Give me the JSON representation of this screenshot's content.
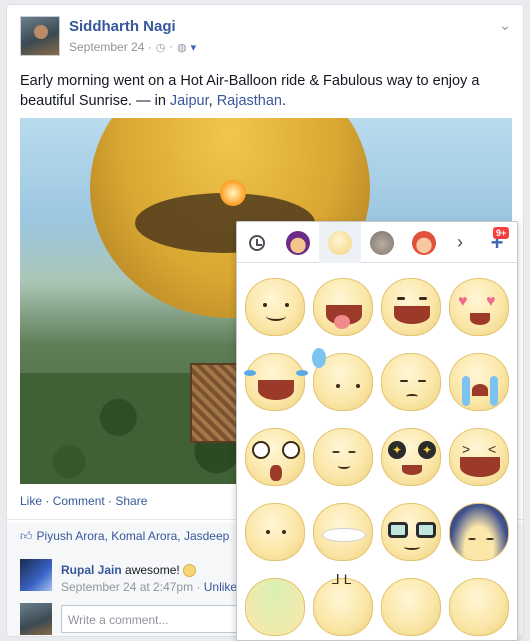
{
  "post": {
    "author": "Siddharth Nagi",
    "date": "September 24 · ",
    "text_main": "Early morning went on a Hot Air-Balloon ride & Fabulous way to enjoy a beautiful Sunrise. — in ",
    "location1": "Jaipur",
    "location_sep": ", ",
    "location2": "Rajasthan",
    "location_end": "."
  },
  "actions": {
    "like": "Like",
    "dot1": " · ",
    "comment": "Comment",
    "dot2": " · ",
    "share": "Share"
  },
  "likes": {
    "names": "Piyush Arora, Komal Arora, Jasdeep"
  },
  "comment": {
    "name": "Rupal Jain",
    "message": " awesome!",
    "time": "September 24 at 2:47pm · ",
    "unlike": "Unlike"
  },
  "write": {
    "placeholder": "Write a comment..."
  },
  "popup": {
    "badge": "9+",
    "stickers": [
      "smile",
      "tongue",
      "grin",
      "heart-eyes",
      "laugh-tears",
      "sweat",
      "worried",
      "crying",
      "shocked",
      "smug",
      "star-eyes",
      "squint-laugh",
      "calm",
      "teeth-grin",
      "glasses",
      "gloom"
    ]
  },
  "colors": {
    "link": "#365899",
    "accent": "#4267b2",
    "badge": "#fa3e3e"
  }
}
